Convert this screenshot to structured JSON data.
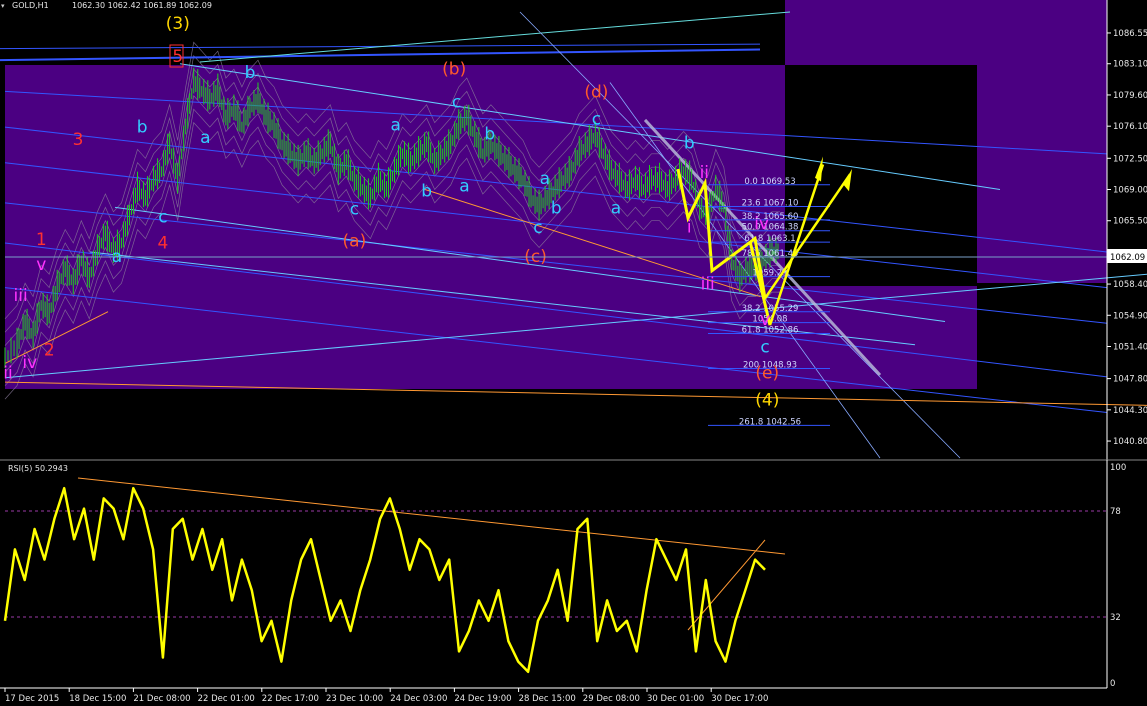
{
  "header": {
    "symbol_tf": "GOLD,H1",
    "ohlc": "1062.30 1062.42 1061.89 1062.09"
  },
  "rsi": {
    "title": "RSI(5) 50.2943",
    "levels": [
      "100",
      "78",
      "32",
      "0"
    ]
  },
  "current_price": "1062.09",
  "colors": {
    "background": "#000000",
    "zone": "#4b0082",
    "price_bars": "#22cc22",
    "rsi_line": "#ffff00",
    "channel": "#66ccff",
    "wave_red": "#ff3030",
    "wave_orange": "#ff5a2a",
    "wave_cyan": "#33ccff",
    "wave_magenta": "#ff33ff",
    "wave_yellow": "#ffd700",
    "trend_orange": "#ff9933",
    "projection": "#ffff00"
  },
  "chart_data": [
    {
      "type": "candlestick",
      "title": "GOLD,H1",
      "ylim": [
        1038.9,
        1088.9
      ],
      "y_ticks": [
        "1086.55",
        "1083.10",
        "1079.60",
        "1076.10",
        "1072.50",
        "1069.00",
        "1065.50",
        "1062.09",
        "1058.40",
        "1054.90",
        "1051.40",
        "1047.80",
        "1044.30",
        "1040.80"
      ],
      "x_ticks": [
        "17 Dec 2015",
        "18 Dec 15:00",
        "21 Dec 08:00",
        "22 Dec 01:00",
        "22 Dec 17:00",
        "23 Dec 10:00",
        "24 Dec 03:00",
        "24 Dec 19:00",
        "28 Dec 15:00",
        "29 Dec 08:00",
        "30 Dec 01:00",
        "30 Dec 17:00"
      ],
      "close_path": [
        [
          0,
          1050
        ],
        [
          6,
          1051.5
        ],
        [
          10,
          1054
        ],
        [
          14,
          1052.5
        ],
        [
          18,
          1056
        ],
        [
          22,
          1055
        ],
        [
          26,
          1058
        ],
        [
          30,
          1060
        ],
        [
          34,
          1058.5
        ],
        [
          38,
          1061
        ],
        [
          42,
          1059
        ],
        [
          46,
          1062
        ],
        [
          50,
          1064
        ],
        [
          54,
          1062
        ],
        [
          58,
          1063
        ],
        [
          62,
          1066
        ],
        [
          66,
          1069
        ],
        [
          70,
          1068
        ],
        [
          74,
          1070
        ],
        [
          78,
          1071
        ],
        [
          82,
          1074
        ],
        [
          86,
          1070
        ],
        [
          90,
          1076
        ],
        [
          94,
          1081
        ],
        [
          98,
          1080
        ],
        [
          102,
          1079
        ],
        [
          106,
          1080
        ],
        [
          110,
          1077
        ],
        [
          114,
          1078
        ],
        [
          118,
          1076
        ],
        [
          122,
          1078
        ],
        [
          126,
          1079
        ],
        [
          130,
          1077
        ],
        [
          134,
          1076
        ],
        [
          138,
          1074
        ],
        [
          142,
          1073
        ],
        [
          146,
          1072
        ],
        [
          150,
          1073
        ],
        [
          154,
          1072
        ],
        [
          158,
          1073
        ],
        [
          162,
          1074
        ],
        [
          166,
          1071
        ],
        [
          170,
          1072
        ],
        [
          174,
          1070
        ],
        [
          178,
          1069
        ],
        [
          182,
          1068
        ],
        [
          186,
          1070
        ],
        [
          190,
          1069
        ],
        [
          194,
          1071
        ],
        [
          198,
          1073
        ],
        [
          202,
          1072
        ],
        [
          206,
          1073
        ],
        [
          210,
          1074
        ],
        [
          214,
          1072
        ],
        [
          218,
          1073
        ],
        [
          222,
          1074
        ],
        [
          226,
          1076
        ],
        [
          230,
          1077
        ],
        [
          234,
          1075
        ],
        [
          238,
          1073
        ],
        [
          242,
          1074
        ],
        [
          246,
          1073
        ],
        [
          250,
          1072
        ],
        [
          254,
          1071
        ],
        [
          258,
          1070
        ],
        [
          262,
          1068
        ],
        [
          266,
          1067
        ],
        [
          270,
          1068
        ],
        [
          274,
          1069
        ],
        [
          278,
          1070
        ],
        [
          282,
          1071
        ],
        [
          286,
          1073
        ],
        [
          290,
          1074
        ],
        [
          294,
          1075
        ],
        [
          298,
          1073
        ],
        [
          302,
          1071
        ],
        [
          306,
          1070
        ],
        [
          310,
          1069
        ],
        [
          314,
          1070
        ],
        [
          318,
          1069
        ],
        [
          322,
          1070
        ],
        [
          326,
          1070
        ],
        [
          330,
          1069
        ],
        [
          334,
          1070
        ],
        [
          338,
          1071
        ],
        [
          342,
          1070
        ],
        [
          346,
          1067
        ],
        [
          350,
          1066
        ],
        [
          354,
          1069
        ],
        [
          358,
          1067
        ],
        [
          362,
          1061
        ],
        [
          366,
          1059
        ],
        [
          370,
          1060
        ],
        [
          374,
          1060
        ],
        [
          378,
          1061
        ],
        [
          382,
          1062
        ],
        [
          386,
          1062
        ]
      ],
      "rsi_path": [
        [
          0,
          30
        ],
        [
          5,
          65
        ],
        [
          10,
          50
        ],
        [
          15,
          75
        ],
        [
          20,
          60
        ],
        [
          25,
          80
        ],
        [
          30,
          95
        ],
        [
          35,
          70
        ],
        [
          40,
          85
        ],
        [
          45,
          60
        ],
        [
          50,
          90
        ],
        [
          55,
          85
        ],
        [
          60,
          70
        ],
        [
          65,
          95
        ],
        [
          70,
          85
        ],
        [
          75,
          65
        ],
        [
          80,
          12
        ],
        [
          85,
          75
        ],
        [
          90,
          80
        ],
        [
          95,
          60
        ],
        [
          100,
          75
        ],
        [
          105,
          55
        ],
        [
          110,
          70
        ],
        [
          115,
          40
        ],
        [
          120,
          60
        ],
        [
          125,
          45
        ],
        [
          130,
          20
        ],
        [
          135,
          30
        ],
        [
          140,
          10
        ],
        [
          145,
          40
        ],
        [
          150,
          60
        ],
        [
          155,
          70
        ],
        [
          160,
          50
        ],
        [
          165,
          30
        ],
        [
          170,
          40
        ],
        [
          175,
          25
        ],
        [
          180,
          45
        ],
        [
          185,
          60
        ],
        [
          190,
          80
        ],
        [
          195,
          90
        ],
        [
          200,
          75
        ],
        [
          205,
          55
        ],
        [
          210,
          70
        ],
        [
          215,
          65
        ],
        [
          220,
          50
        ],
        [
          225,
          60
        ],
        [
          230,
          15
        ],
        [
          235,
          25
        ],
        [
          240,
          40
        ],
        [
          245,
          30
        ],
        [
          250,
          45
        ],
        [
          255,
          20
        ],
        [
          260,
          10
        ],
        [
          265,
          5
        ],
        [
          270,
          30
        ],
        [
          275,
          40
        ],
        [
          280,
          55
        ],
        [
          285,
          30
        ],
        [
          290,
          75
        ],
        [
          295,
          80
        ],
        [
          300,
          20
        ],
        [
          305,
          40
        ],
        [
          310,
          25
        ],
        [
          315,
          30
        ],
        [
          320,
          15
        ],
        [
          325,
          45
        ],
        [
          330,
          70
        ],
        [
          335,
          60
        ],
        [
          340,
          50
        ],
        [
          345,
          65
        ],
        [
          350,
          15
        ],
        [
          355,
          50
        ],
        [
          360,
          20
        ],
        [
          365,
          10
        ],
        [
          370,
          30
        ],
        [
          375,
          45
        ],
        [
          380,
          60
        ],
        [
          385,
          55
        ]
      ],
      "fib_levels": [
        {
          "label": "0.0 1069.53",
          "price": 1069.53
        },
        {
          "label": "23.6 1067.10",
          "price": 1067.1
        },
        {
          "label": "38.2 1065.60",
          "price": 1065.6
        },
        {
          "label": "50.0 1064.38",
          "price": 1064.38
        },
        {
          "label": "61.8 1063.1",
          "price": 1063.1
        },
        {
          "label": "78.6 1061.45",
          "price": 1061.45
        },
        {
          "label": "1059.23",
          "price": 1059.23
        },
        {
          "label": "38.2 1055.29",
          "price": 1055.29
        },
        {
          "label": "1054.08",
          "price": 1054.08
        },
        {
          "label": "61.8 1052.86",
          "price": 1052.86
        },
        {
          "label": "200 1048.93",
          "price": 1048.93
        },
        {
          "label": "261.8 1042.56",
          "price": 1042.56
        }
      ],
      "wave_labels": [
        {
          "text": "(3)",
          "color": "#ffd700",
          "x": 0.155,
          "price": 1087
        },
        {
          "text": "5",
          "color": "#ff3030",
          "x": 0.155,
          "price": 1083.3
        },
        {
          "text": "3",
          "color": "#ff3030",
          "x": 0.068,
          "price": 1074
        },
        {
          "text": "1",
          "color": "#ff3030",
          "x": 0.036,
          "price": 1062.8
        },
        {
          "text": "2",
          "color": "#ff3030",
          "x": 0.043,
          "price": 1050.4
        },
        {
          "text": "4",
          "color": "#ff3030",
          "x": 0.142,
          "price": 1062.4
        },
        {
          "text": "v",
          "color": "#ff33ff",
          "x": 0.036,
          "price": 1060
        },
        {
          "text": "iii",
          "color": "#ff33ff",
          "x": 0.018,
          "price": 1056.5
        },
        {
          "text": "iv",
          "color": "#ff33ff",
          "x": 0.026,
          "price": 1049
        },
        {
          "text": "ii",
          "color": "#ff33ff",
          "x": 0.007,
          "price": 1047.8
        },
        {
          "text": "a",
          "color": "#33ccff",
          "x": 0.102,
          "price": 1060.9
        },
        {
          "text": "c",
          "color": "#33ccff",
          "x": 0.142,
          "price": 1065.3
        },
        {
          "text": "b",
          "color": "#33ccff",
          "x": 0.124,
          "price": 1075.4
        },
        {
          "text": "a",
          "color": "#33ccff",
          "x": 0.179,
          "price": 1074.2
        },
        {
          "text": "b",
          "color": "#33ccff",
          "x": 0.218,
          "price": 1081.5
        },
        {
          "text": "(a)",
          "color": "#ff5a2a",
          "x": 0.309,
          "price": 1062.6
        },
        {
          "text": "c",
          "color": "#33ccff",
          "x": 0.309,
          "price": 1066.2
        },
        {
          "text": "b",
          "color": "#33ccff",
          "x": 0.372,
          "price": 1068.2
        },
        {
          "text": "a",
          "color": "#33ccff",
          "x": 0.345,
          "price": 1075.6
        },
        {
          "text": "(b)",
          "color": "#ff5a2a",
          "x": 0.396,
          "price": 1081.9
        },
        {
          "text": "c",
          "color": "#33ccff",
          "x": 0.398,
          "price": 1078.2
        },
        {
          "text": "b",
          "color": "#33ccff",
          "x": 0.427,
          "price": 1074.6
        },
        {
          "text": "a",
          "color": "#33ccff",
          "x": 0.405,
          "price": 1068.8
        },
        {
          "text": "(c)",
          "color": "#ff5a2a",
          "x": 0.467,
          "price": 1060.9
        },
        {
          "text": "c",
          "color": "#33ccff",
          "x": 0.469,
          "price": 1064.1
        },
        {
          "text": "b",
          "color": "#33ccff",
          "x": 0.485,
          "price": 1066.3
        },
        {
          "text": "a",
          "color": "#33ccff",
          "x": 0.475,
          "price": 1069.6
        },
        {
          "text": "(d)",
          "color": "#ff5a2a",
          "x": 0.52,
          "price": 1079.3
        },
        {
          "text": "c",
          "color": "#33ccff",
          "x": 0.52,
          "price": 1076.3
        },
        {
          "text": "a",
          "color": "#33ccff",
          "x": 0.537,
          "price": 1066.3
        },
        {
          "text": "b",
          "color": "#33ccff",
          "x": 0.601,
          "price": 1073.6
        },
        {
          "text": "ii",
          "color": "#ff33ff",
          "x": 0.614,
          "price": 1070.3
        },
        {
          "text": "i",
          "color": "#ff33ff",
          "x": 0.601,
          "price": 1064.2
        },
        {
          "text": "iii",
          "color": "#ff33ff",
          "x": 0.617,
          "price": 1057.8
        },
        {
          "text": "iv",
          "color": "#ff33ff",
          "x": 0.664,
          "price": 1064.6
        },
        {
          "text": "v",
          "color": "#ff33ff",
          "x": 0.667,
          "price": 1053.8
        },
        {
          "text": "c",
          "color": "#33ccff",
          "x": 0.667,
          "price": 1050.7
        },
        {
          "text": "(e)",
          "color": "#ff5a2a",
          "x": 0.669,
          "price": 1047.8
        },
        {
          "text": "(4)",
          "color": "#ffd700",
          "x": 0.669,
          "price": 1044.8
        }
      ]
    },
    {
      "type": "line",
      "title": "RSI(5) 50.2943",
      "ylim": [
        0,
        100
      ],
      "y_ticks": [
        "100",
        "78",
        "32",
        "0"
      ]
    }
  ]
}
